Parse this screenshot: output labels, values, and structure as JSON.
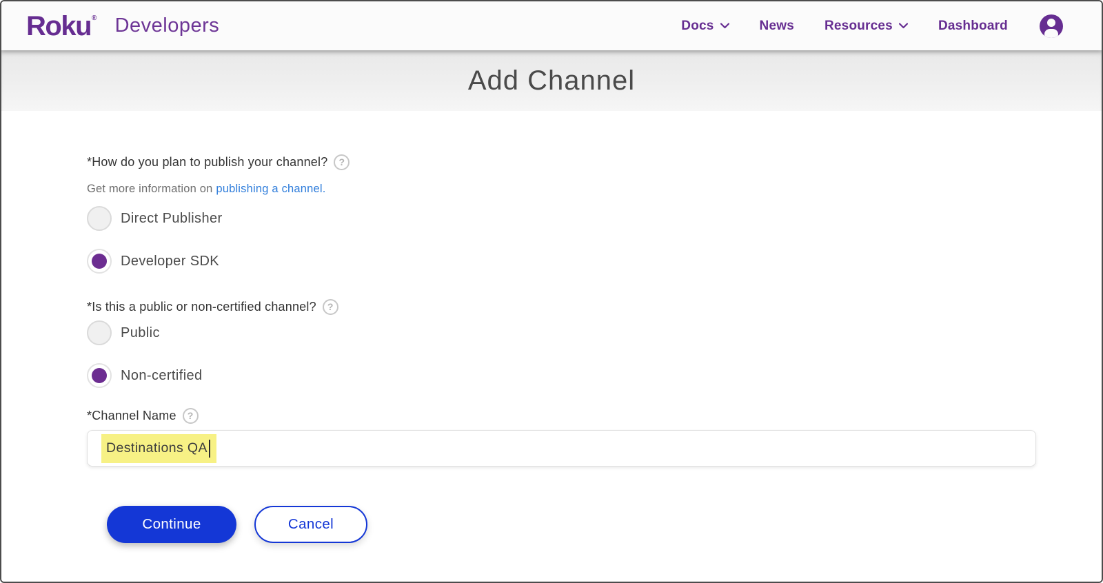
{
  "header": {
    "logo": "Roku",
    "logo_reg": "®",
    "brand": "Developers",
    "nav": [
      {
        "label": "Docs",
        "has_chevron": true
      },
      {
        "label": "News",
        "has_chevron": false
      },
      {
        "label": "Resources",
        "has_chevron": true
      },
      {
        "label": "Dashboard",
        "has_chevron": false
      }
    ],
    "avatar_icon": "account-icon"
  },
  "page": {
    "title": "Add Channel"
  },
  "form": {
    "help_glyph": "?",
    "q_publish": {
      "label": "*How do you plan to publish your channel?",
      "info_prefix": "Get more information on ",
      "info_link": "publishing a channel.",
      "options": [
        {
          "label": "Direct Publisher",
          "selected": false
        },
        {
          "label": "Developer SDK",
          "selected": true
        }
      ]
    },
    "q_certified": {
      "label": "*Is this a public or non-certified channel?",
      "options": [
        {
          "label": "Public",
          "selected": false
        },
        {
          "label": "Non-certified",
          "selected": true
        }
      ]
    },
    "channel_name": {
      "label": "*Channel Name",
      "value": "Destinations QA"
    },
    "buttons": {
      "continue": "Continue",
      "cancel": "Cancel"
    }
  },
  "colors": {
    "brand_purple": "#662d91",
    "radio_purple": "#6c2d91",
    "action_blue": "#1437d6",
    "link_blue": "#2f7ddb",
    "highlight_yellow": "#f7f185",
    "title_text": "#4a4a4a"
  }
}
